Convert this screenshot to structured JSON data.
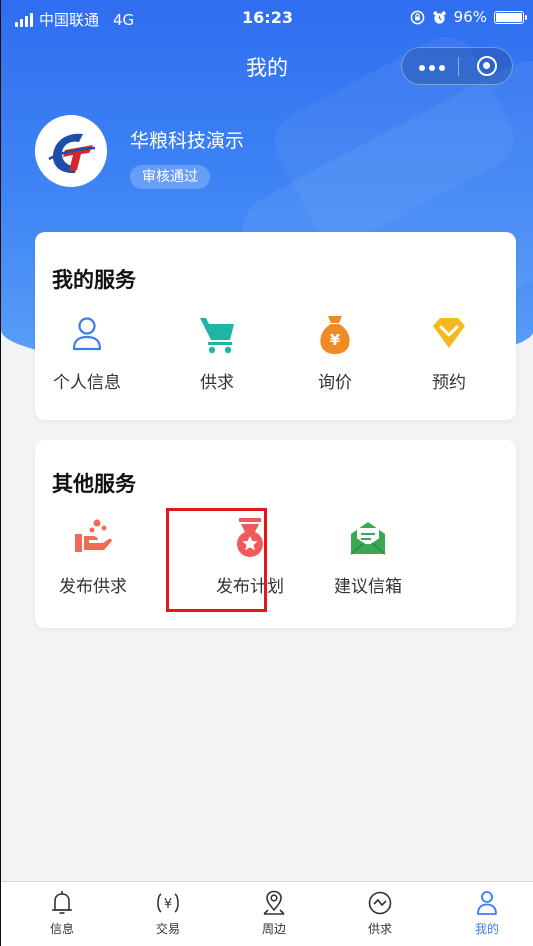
{
  "status_bar": {
    "carrier": "中国联通",
    "network": "4G",
    "time": "16:23",
    "battery": "96%"
  },
  "nav": {
    "title": "我的"
  },
  "profile": {
    "name": "华粮科技演示",
    "status_badge": "审核通过"
  },
  "my_services": {
    "title": "我的服务",
    "items": [
      {
        "label": "个人信息",
        "icon": "person-icon"
      },
      {
        "label": "供求",
        "icon": "cart-icon"
      },
      {
        "label": "询价",
        "icon": "money-bag-icon"
      },
      {
        "label": "预约",
        "icon": "diamond-icon"
      }
    ]
  },
  "other_services": {
    "title": "其他服务",
    "items": [
      {
        "label": "发布供求",
        "icon": "hand-give-icon"
      },
      {
        "label": "发布计划",
        "icon": "medal-icon"
      },
      {
        "label": "建议信箱",
        "icon": "envelope-icon"
      }
    ]
  },
  "tabbar": {
    "items": [
      {
        "label": "信息",
        "icon": "bell-icon"
      },
      {
        "label": "交易",
        "icon": "yuan-coin-icon"
      },
      {
        "label": "周边",
        "icon": "location-pin-icon"
      },
      {
        "label": "供求",
        "icon": "exchange-icon"
      },
      {
        "label": "我的",
        "icon": "person-icon",
        "active": true
      }
    ]
  },
  "colors": {
    "primary_blue": "#3b7cf0",
    "highlight_red": "#e21818",
    "cart_teal": "#1fb5a6",
    "money_orange": "#f08a24",
    "diamond_yellow": "#f5b81e",
    "hand_red": "#f06a55",
    "medal_red": "#f05a5a",
    "envelope_green": "#3aa855"
  }
}
